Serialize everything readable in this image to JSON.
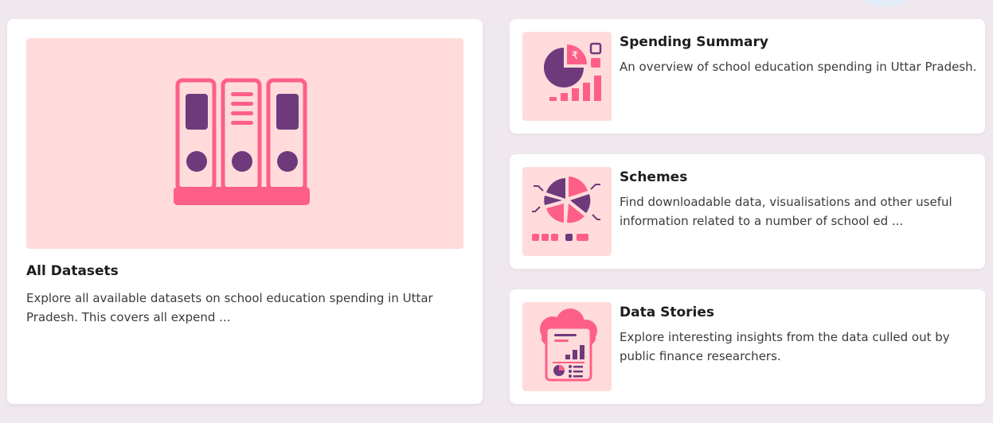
{
  "colors": {
    "background": "#efe9ef",
    "card": "#ffffff",
    "illustration_bg": "#ffdcdb",
    "accent_pink": "#fe5f88",
    "accent_purple": "#6f3a7c"
  },
  "featured": {
    "title": "All Datasets",
    "description": "Explore all available datasets on school education spending in Uttar Pradesh. This covers all expend ...",
    "icon": "binders-icon"
  },
  "cards": [
    {
      "title": "Spending Summary",
      "description": "An overview of school education spending in Uttar Pradesh.",
      "icon": "spending-chart-icon"
    },
    {
      "title": "Schemes",
      "description": "Find downloadable data, visualisations and other useful information related to a number of school ed ...",
      "icon": "pie-schemes-icon"
    },
    {
      "title": "Data Stories",
      "description": "Explore interesting insights from the data culled out by public finance researchers.",
      "icon": "cloud-report-icon"
    }
  ]
}
